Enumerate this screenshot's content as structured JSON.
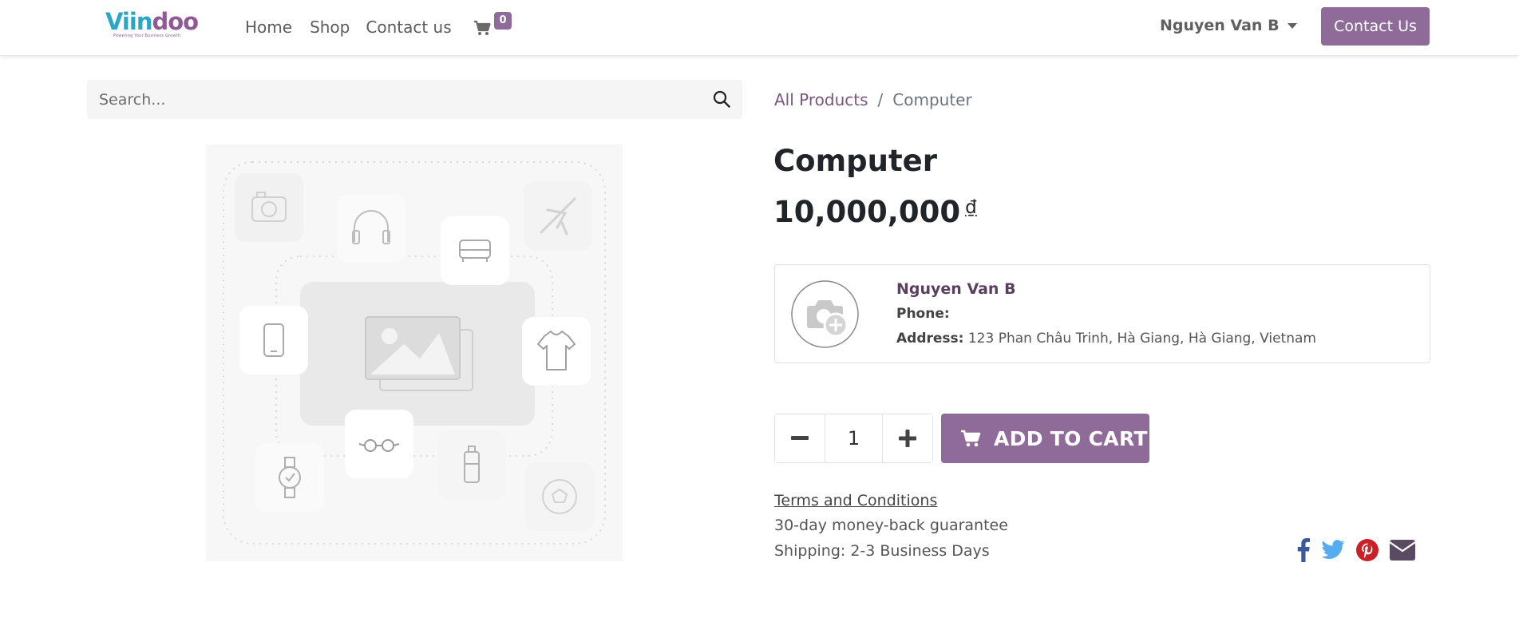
{
  "brand": {
    "logo_text_part1": "Viin",
    "logo_text_part2": "doo",
    "tagline": "Powering Your Business Growth",
    "accent_color": "#8f6b9a",
    "logo_color_teal": "#2ba6c4"
  },
  "header": {
    "nav": [
      {
        "label": "Home"
      },
      {
        "label": "Shop"
      },
      {
        "label": "Contact us"
      }
    ],
    "cart_icon": "shopping-cart-icon",
    "cart_count": "0",
    "user_name": "Nguyen Van B",
    "contact_button": "Contact Us"
  },
  "search": {
    "placeholder": "Search...",
    "icon": "search-icon"
  },
  "breadcrumb": {
    "parent": "All Products",
    "separator": "/",
    "current": "Computer"
  },
  "product": {
    "title": "Computer",
    "price": "10,000,000",
    "currency": "₫",
    "image_placeholder_icons": [
      "camera-icon",
      "headphones-icon",
      "sofa-icon",
      "airplane-icon",
      "smartphone-icon",
      "image-icon",
      "tshirt-icon",
      "glasses-icon",
      "watch-icon",
      "bottle-icon",
      "soccer-ball-icon"
    ]
  },
  "seller": {
    "name": "Nguyen Van B",
    "phone_label": "Phone:",
    "phone_value": "",
    "address_label": "Address:",
    "address_value": "123 Phan Châu Trinh, Hà Giang, Hà Giang, Vietnam",
    "avatar_icon": "add-photo-icon"
  },
  "cart_form": {
    "quantity": "1",
    "decrease_icon": "minus-icon",
    "increase_icon": "plus-icon",
    "add_to_cart_label": "ADD TO CART"
  },
  "info": {
    "terms": "Terms and Conditions",
    "guarantee": "30-day money-back guarantee",
    "shipping": "Shipping: 2-3 Business Days"
  },
  "share": {
    "icons": [
      "facebook-icon",
      "twitter-icon",
      "pinterest-icon",
      "email-icon"
    ],
    "colors": {
      "facebook": "#3b5998",
      "twitter": "#55acee",
      "pinterest": "#cb2027",
      "email": "#5a4a63"
    }
  }
}
